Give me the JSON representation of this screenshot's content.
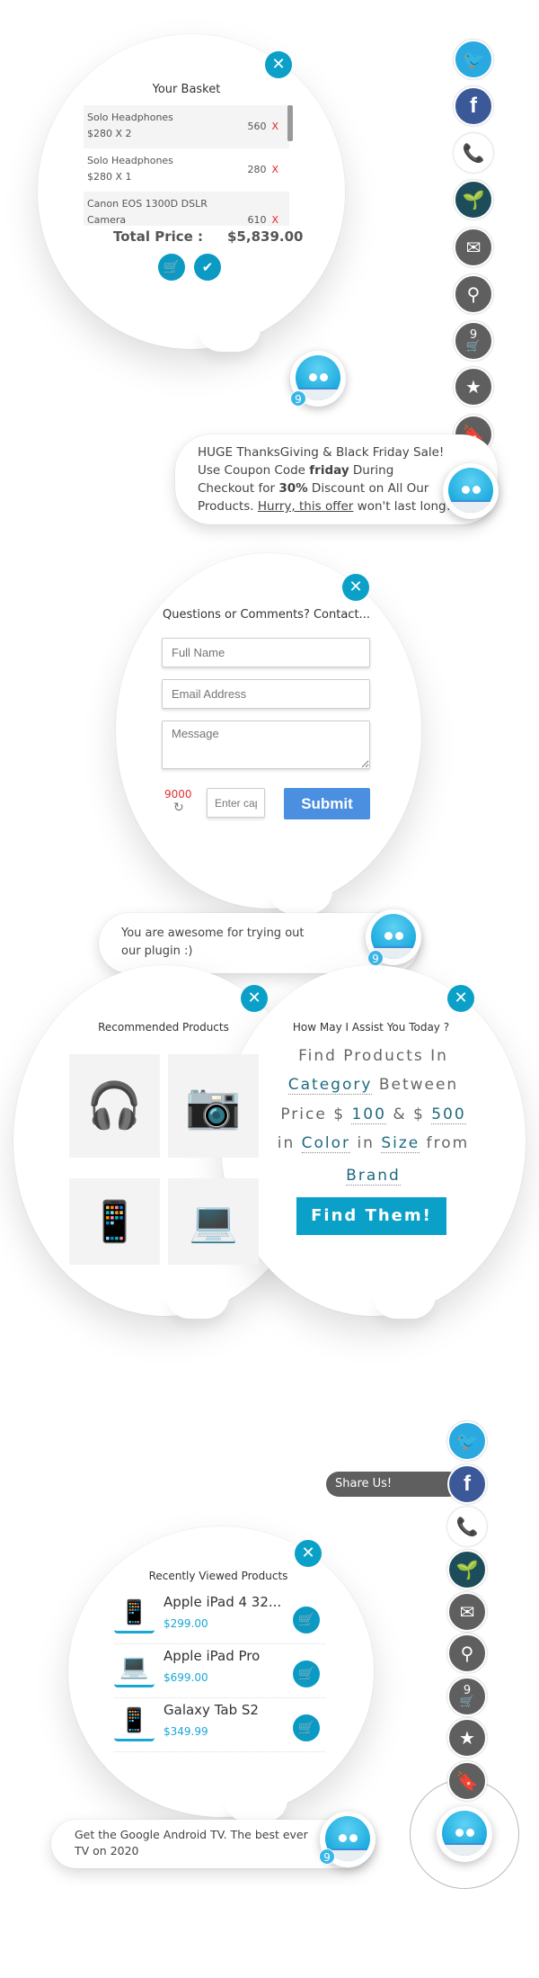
{
  "basket": {
    "title": "Your Basket",
    "items": [
      {
        "name": "Solo Headphones",
        "qty": "$280 X 2",
        "amount": "560",
        "remove": "X"
      },
      {
        "name": "Solo Headphones",
        "qty": "$280 X 1",
        "amount": "280",
        "remove": "X"
      },
      {
        "name": "Canon EOS 1300D DSLR Camera",
        "qty": "",
        "amount": "610",
        "remove": "X"
      }
    ],
    "total_label": "Total Price :",
    "total_value": "$5,839.00"
  },
  "social": {
    "badge": "9",
    "share_label": "Share Us!"
  },
  "bot_badge": "9",
  "promo": {
    "line1": "HUGE ThanksGiving & Black Friday Sale!",
    "l2a": "Use Coupon Code ",
    "l2b": "friday",
    "l2c": " During",
    "l3a": "Checkout for ",
    "l3b": "30%",
    "l3c": " Discount on All Our",
    "l4a": "Products. ",
    "l4b": "Hurry, this offer",
    "l4c": " won't last long!"
  },
  "contact": {
    "title": "Questions or Comments? Contact...",
    "name_ph": "Full Name",
    "email_ph": "Email Address",
    "message_ph": "Message",
    "captcha": "9000",
    "captcha_ph": "Enter captcha",
    "submit": "Submit"
  },
  "awesome": {
    "text": "You are awesome for trying out our plugin :)"
  },
  "recommended": {
    "title": "Recommended Products"
  },
  "finder": {
    "title": "How May I Assist You Today ?",
    "t1": "Find Products In",
    "category": "Category",
    "t2": "Between",
    "t3": "Price $",
    "min": "100",
    "t4": "& $",
    "max": "500",
    "t5": "in",
    "color": "Color",
    "t6": "in",
    "size": "Size",
    "t7": "from",
    "brand": "Brand",
    "button": "Find Them!"
  },
  "recent": {
    "title": "Recently Viewed Products",
    "items": [
      {
        "name": "Apple iPad 4 32...",
        "price": "$299.00"
      },
      {
        "name": "Apple iPad Pro",
        "price": "$699.00"
      },
      {
        "name": "Galaxy Tab S2",
        "price": "$349.99"
      }
    ]
  },
  "android": {
    "text": "Get the Google Android TV. The best ever TV on 2020"
  },
  "colors": {
    "accent": "#0aa0c8",
    "social_gray": "#5f5f5f",
    "twitter": "#2aa9e0",
    "facebook": "#3b5998",
    "submit": "#4a8fe0"
  }
}
